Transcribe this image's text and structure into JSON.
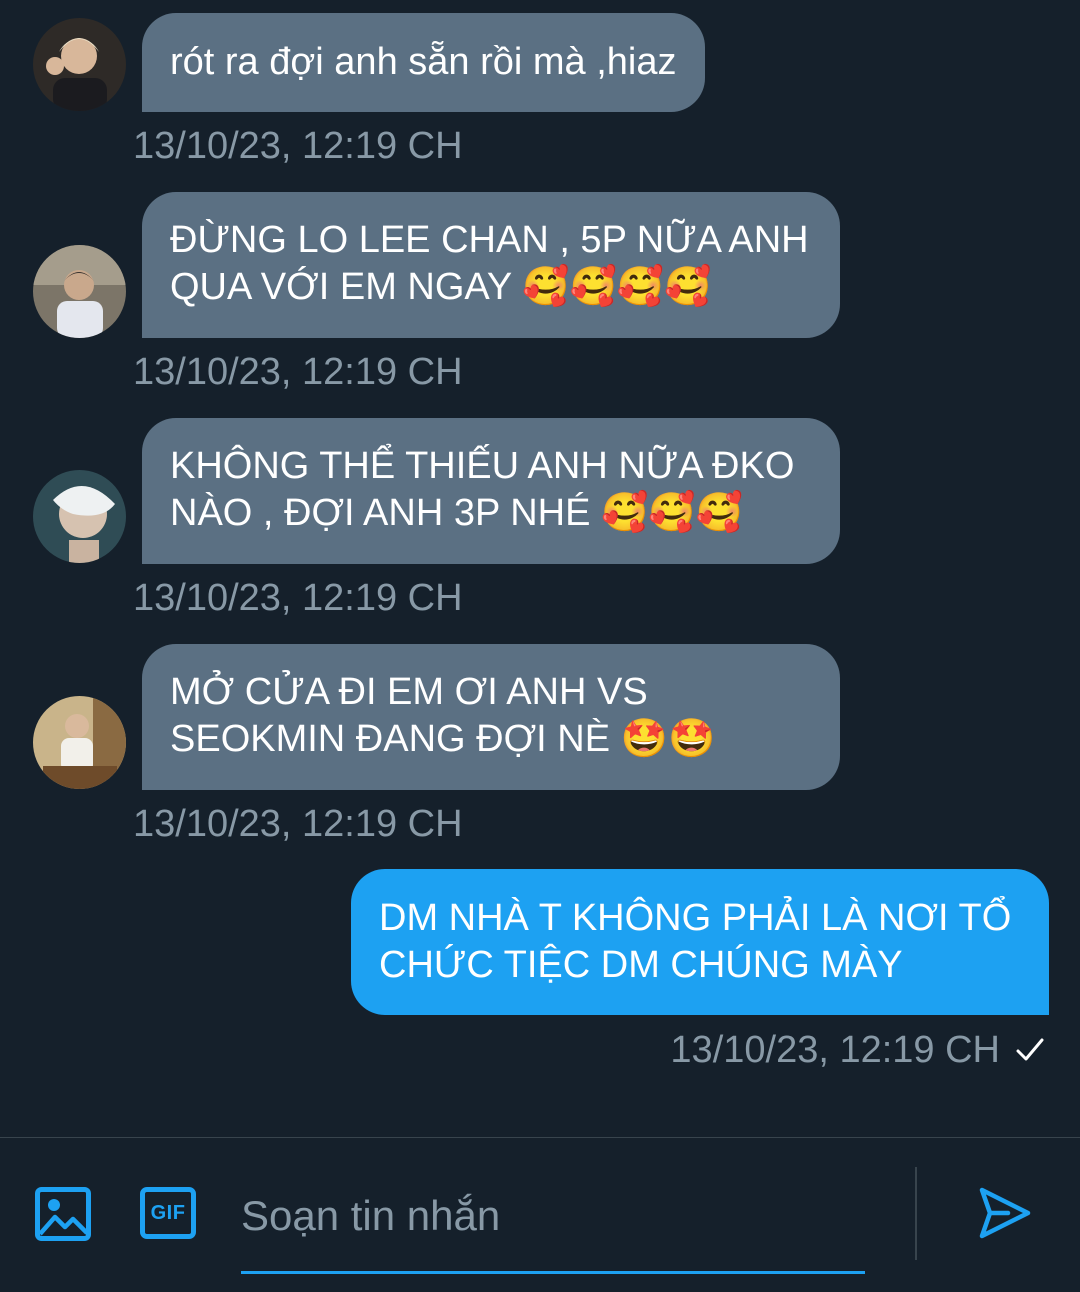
{
  "conversation": {
    "messages": [
      {
        "direction": "incoming",
        "lines": [
          "rót ra đợi anh sẵn rồi mà ,hiaz"
        ],
        "timestamp": "13/10/23, 12:19 CH"
      },
      {
        "direction": "incoming",
        "lines": [
          "ĐỪNG LO LEE CHAN , 5P NỮA ANH",
          "QUA VỚI EM NGAY 🥰🥰🥰🥰"
        ],
        "timestamp": "13/10/23, 12:19 CH"
      },
      {
        "direction": "incoming",
        "lines": [
          "KHÔNG THỂ THIẾU ANH NỮA ĐKO",
          "NÀO , ĐỢI ANH 3P NHÉ 🥰🥰🥰"
        ],
        "timestamp": "13/10/23, 12:19 CH"
      },
      {
        "direction": "incoming",
        "lines": [
          "MỞ CỬA ĐI EM ƠI ANH VS",
          "SEOKMIN ĐANG ĐỢI NÈ 🤩🤩"
        ],
        "timestamp": "13/10/23, 12:19 CH"
      },
      {
        "direction": "outgoing",
        "lines": [
          "DM NHÀ T KHÔNG PHẢI LÀ NƠI TỔ",
          "CHỨC TIỆC DM CHÚNG MÀY"
        ],
        "timestamp": "13/10/23, 12:19 CH",
        "status_icon": "checkmark-icon"
      }
    ]
  },
  "composer": {
    "image_icon": "image-icon",
    "gif_label": "GIF",
    "placeholder": "Soạn tin nhắn",
    "value": "",
    "send_icon": "send-icon"
  },
  "colors": {
    "background": "#15202b",
    "incoming_bubble": "#5b7083",
    "outgoing_bubble": "#1da1f2",
    "timestamp": "#8899a6",
    "accent": "#1da1f2",
    "divider": "#38444d"
  }
}
